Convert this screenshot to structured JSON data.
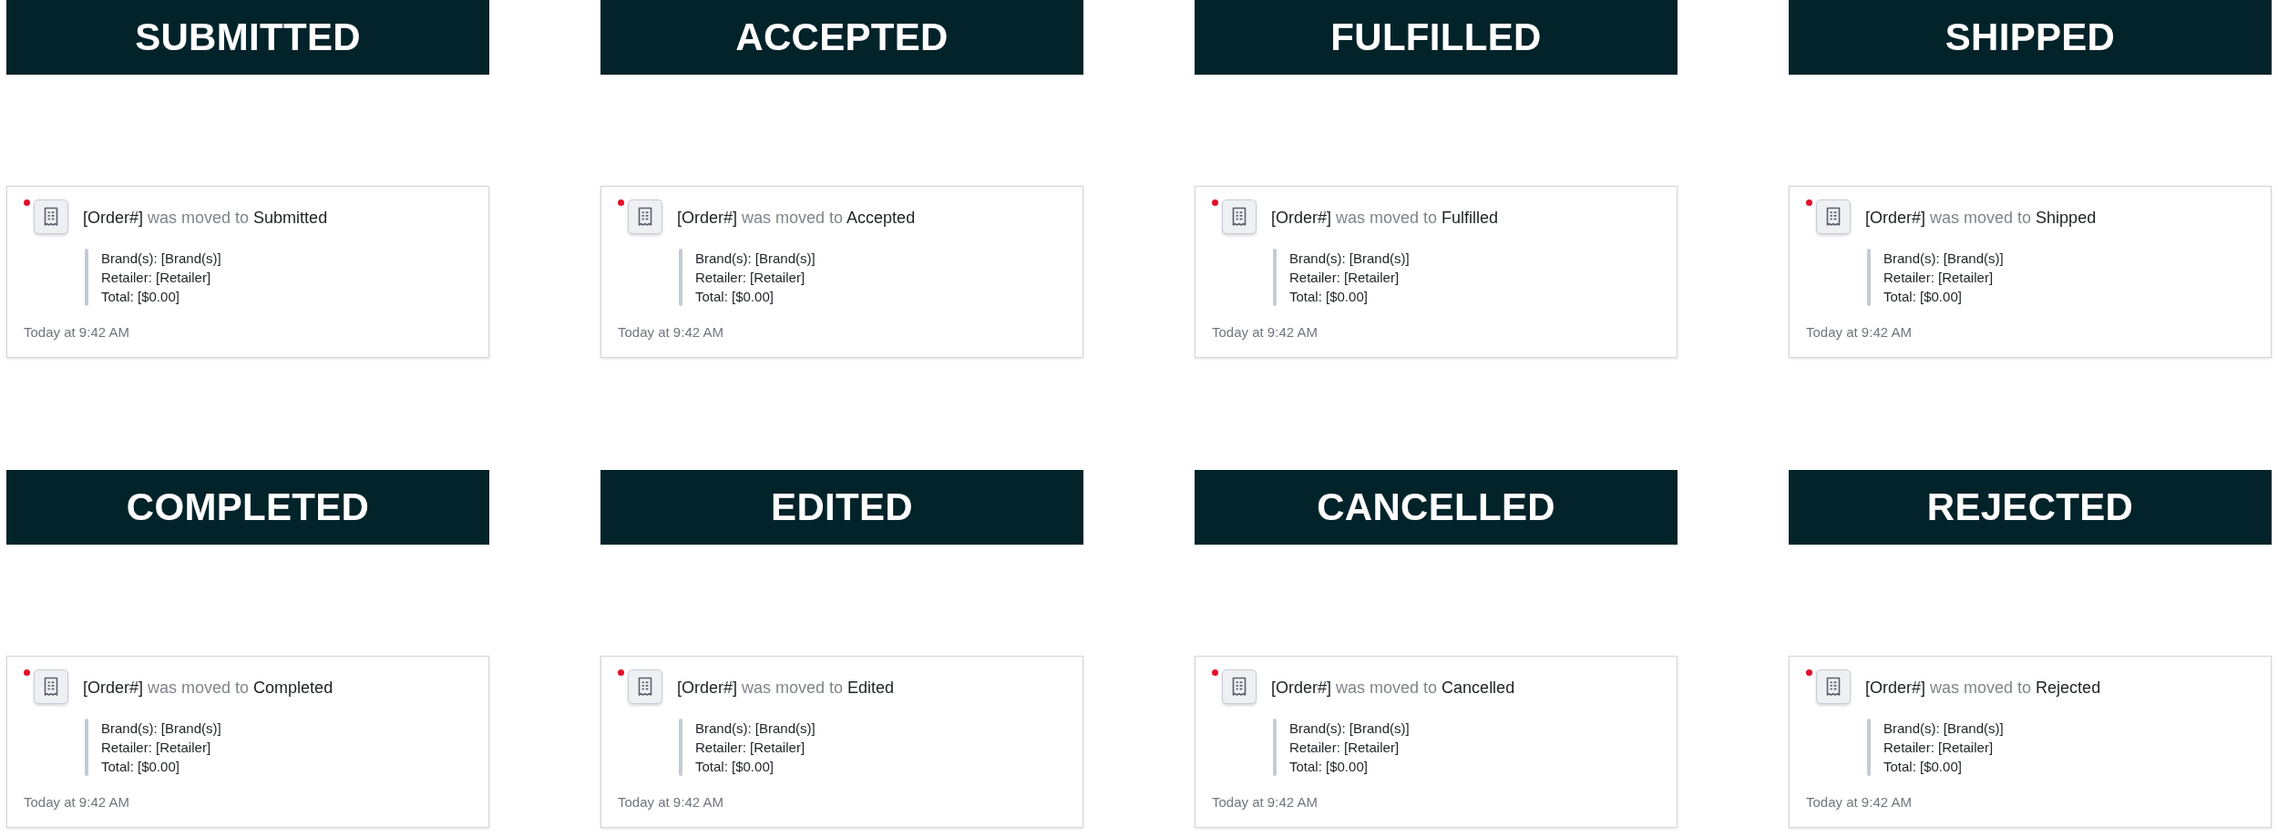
{
  "panels": [
    {
      "heading": "SUBMITTED",
      "notification": {
        "unread": true,
        "title": "**[Order#]** was moved to **Submitted**",
        "details": [
          "Brand(s): [Brand(s)]",
          "Retailer: [Retailer]",
          "Total: [$0.00]"
        ],
        "time": "Today at 9:42 AM"
      }
    },
    {
      "heading": "ACCEPTED",
      "notification": {
        "unread": true,
        "title": "**[Order#]** was moved to **Accepted**",
        "details": [
          "Brand(s): [Brand(s)]",
          "Retailer: [Retailer]",
          "Total: [$0.00]"
        ],
        "time": "Today at 9:42 AM"
      }
    },
    {
      "heading": "FULFILLED",
      "notification": {
        "unread": true,
        "title": "**[Order#]** was moved to **Fulfilled**",
        "details": [
          "Brand(s): [Brand(s)]",
          "Retailer: [Retailer]",
          "Total: [$0.00]"
        ],
        "time": "Today at 9:42 AM"
      }
    },
    {
      "heading": "SHIPPED",
      "notification": {
        "unread": true,
        "title": "**[Order#]** was moved to **Shipped**",
        "details": [
          "Brand(s): [Brand(s)]",
          "Retailer: [Retailer]",
          "Total: [$0.00]"
        ],
        "time": "Today at 9:42 AM"
      }
    },
    {
      "heading": "COMPLETED",
      "notification": {
        "unread": true,
        "title": "**[Order#]** was moved to **Completed**",
        "details": [
          "Brand(s): [Brand(s)]",
          "Retailer: [Retailer]",
          "Total: [$0.00]"
        ],
        "time": "Today at 9:42 AM"
      }
    },
    {
      "heading": "EDITED",
      "notification": {
        "unread": true,
        "title": "**[Order#]** was moved to **Edited**",
        "details": [
          "Brand(s): [Brand(s)]",
          "Retailer: [Retailer]",
          "Total: [$0.00]"
        ],
        "time": "Today at 9:42 AM"
      }
    },
    {
      "heading": "CANCELLED",
      "notification": {
        "unread": true,
        "title": "**[Order#]** was moved to **Cancelled**",
        "details": [
          "Brand(s): [Brand(s)]",
          "Retailer: [Retailer]",
          "Total: [$0.00]"
        ],
        "time": "Today at 9:42 AM"
      }
    },
    {
      "heading": "REJECTED",
      "notification": {
        "unread": true,
        "title": "**[Order#]** was moved to **Rejected**",
        "details": [
          "Brand(s): [Brand(s)]",
          "Retailer: [Retailer]",
          "Total: [$0.00]"
        ],
        "time": "Today at 9:42 AM"
      }
    }
  ]
}
